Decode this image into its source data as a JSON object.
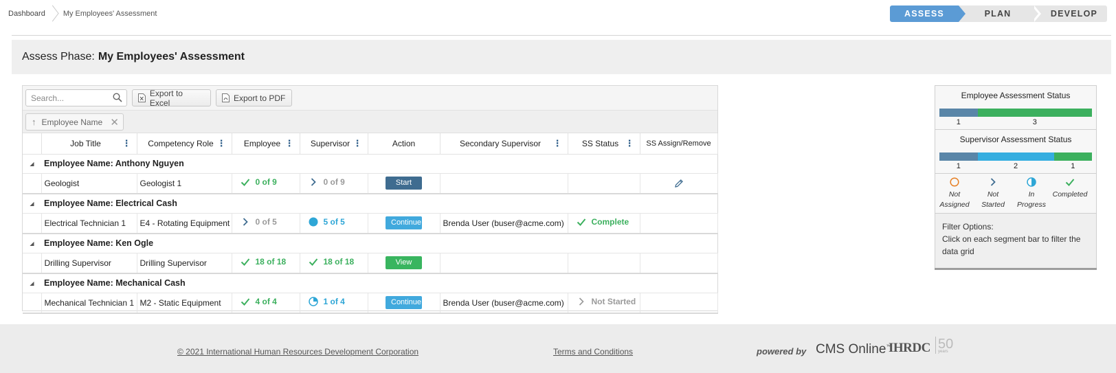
{
  "breadcrumb": {
    "home": "Dashboard",
    "current": "My Employees' Assessment"
  },
  "phases": [
    {
      "label": "ASSESS",
      "active": true
    },
    {
      "label": "PLAN",
      "active": false
    },
    {
      "label": "DEVELOP",
      "active": false
    }
  ],
  "title": {
    "prefix": "Assess Phase:",
    "name": "My Employees' Assessment"
  },
  "toolbar": {
    "search_placeholder": "Search...",
    "export_excel": "Export to Excel",
    "export_pdf": "Export to PDF"
  },
  "grouping": {
    "chip_label": "Employee Name"
  },
  "columns": [
    "Job Title",
    "Competency Role",
    "Employee",
    "Supervisor",
    "Action",
    "Secondary Supervisor",
    "SS Status",
    "SS Assign/Remove"
  ],
  "groups": [
    {
      "header": "Employee Name: Anthony Nguyen",
      "job_title": "Geologist",
      "role": "Geologist 1",
      "employee": {
        "icon": "check-icon",
        "text": "0 of 9",
        "color": "green"
      },
      "supervisor": {
        "icon": "chevron-right-icon",
        "text": "0 of 9",
        "color": "gray"
      },
      "action": "Start",
      "secondary": "",
      "ss_status": "",
      "ss_assign_icon": "pencil-icon"
    },
    {
      "header": "Employee Name: Electrical Cash",
      "job_title": "Electrical Technician 1",
      "role": "E4 - Rotating Equipment",
      "employee": {
        "icon": "chevron-right-icon",
        "text": "0 of 5",
        "color": "gray"
      },
      "supervisor": {
        "icon": "full-circle-icon",
        "text": "5 of 5",
        "color": "blue"
      },
      "action": "Continue",
      "secondary": "Brenda User (buser@acme.com)",
      "ss_status": "Complete",
      "ss_assign_icon": ""
    },
    {
      "header": "Employee Name: Ken Ogle",
      "job_title": "Drilling Supervisor",
      "role": "Drilling Supervisor",
      "employee": {
        "icon": "check-icon",
        "text": "18 of 18",
        "color": "green"
      },
      "supervisor": {
        "icon": "check-icon",
        "text": "18 of 18",
        "color": "green"
      },
      "action": "View",
      "secondary": "",
      "ss_status": "",
      "ss_assign_icon": ""
    },
    {
      "header": "Employee Name: Mechanical Cash",
      "job_title": "Mechanical Technician 1",
      "role": "M2 - Static Equipment",
      "employee": {
        "icon": "check-icon",
        "text": "4 of 4",
        "color": "green"
      },
      "supervisor": {
        "icon": "quarter-pie-icon",
        "text": "1 of 4",
        "color": "blue"
      },
      "action": "Continue",
      "secondary": "Brenda User (buser@acme.com)",
      "ss_status": "Not Started",
      "ss_assign_icon": ""
    }
  ],
  "status_panel": {
    "employee_title": "Employee Assessment Status",
    "employee_segments": [
      {
        "label": "1",
        "value": 1,
        "color": "#5a86a8"
      },
      {
        "label": "3",
        "value": 3,
        "color": "#3cb05e"
      }
    ],
    "supervisor_title": "Supervisor Assessment Status",
    "supervisor_segments": [
      {
        "label": "1",
        "value": 1,
        "color": "#5a86a8"
      },
      {
        "label": "2",
        "value": 2,
        "color": "#35aee0"
      },
      {
        "label": "1",
        "value": 1,
        "color": "#3cb05e"
      }
    ],
    "legend": [
      {
        "icon": "open-circle-icon",
        "line1": "Not",
        "line2": "Assigned"
      },
      {
        "icon": "chevron-right-icon",
        "line1": "Not",
        "line2": "Started"
      },
      {
        "icon": "half-circle-icon",
        "line1": "In",
        "line2": "Progress"
      },
      {
        "icon": "check-icon",
        "line1": "Completed",
        "line2": ""
      }
    ],
    "filter_title": "Filter Options:",
    "filter_text": "Click on each segment bar to filter the data grid"
  },
  "footer": {
    "copyright": "© 2021 International Human Resources Development Corporation",
    "terms": "Terms and Conditions",
    "powered_by": "powered by",
    "cms": "CMS Online",
    "ihrdc": "IHRDC",
    "fifty": "50",
    "years": "years"
  },
  "colors": {
    "accent": "#5b9bd5",
    "green": "#3cb05e",
    "blue": "#2ea6d6",
    "dark_blue": "#3f6c90"
  }
}
